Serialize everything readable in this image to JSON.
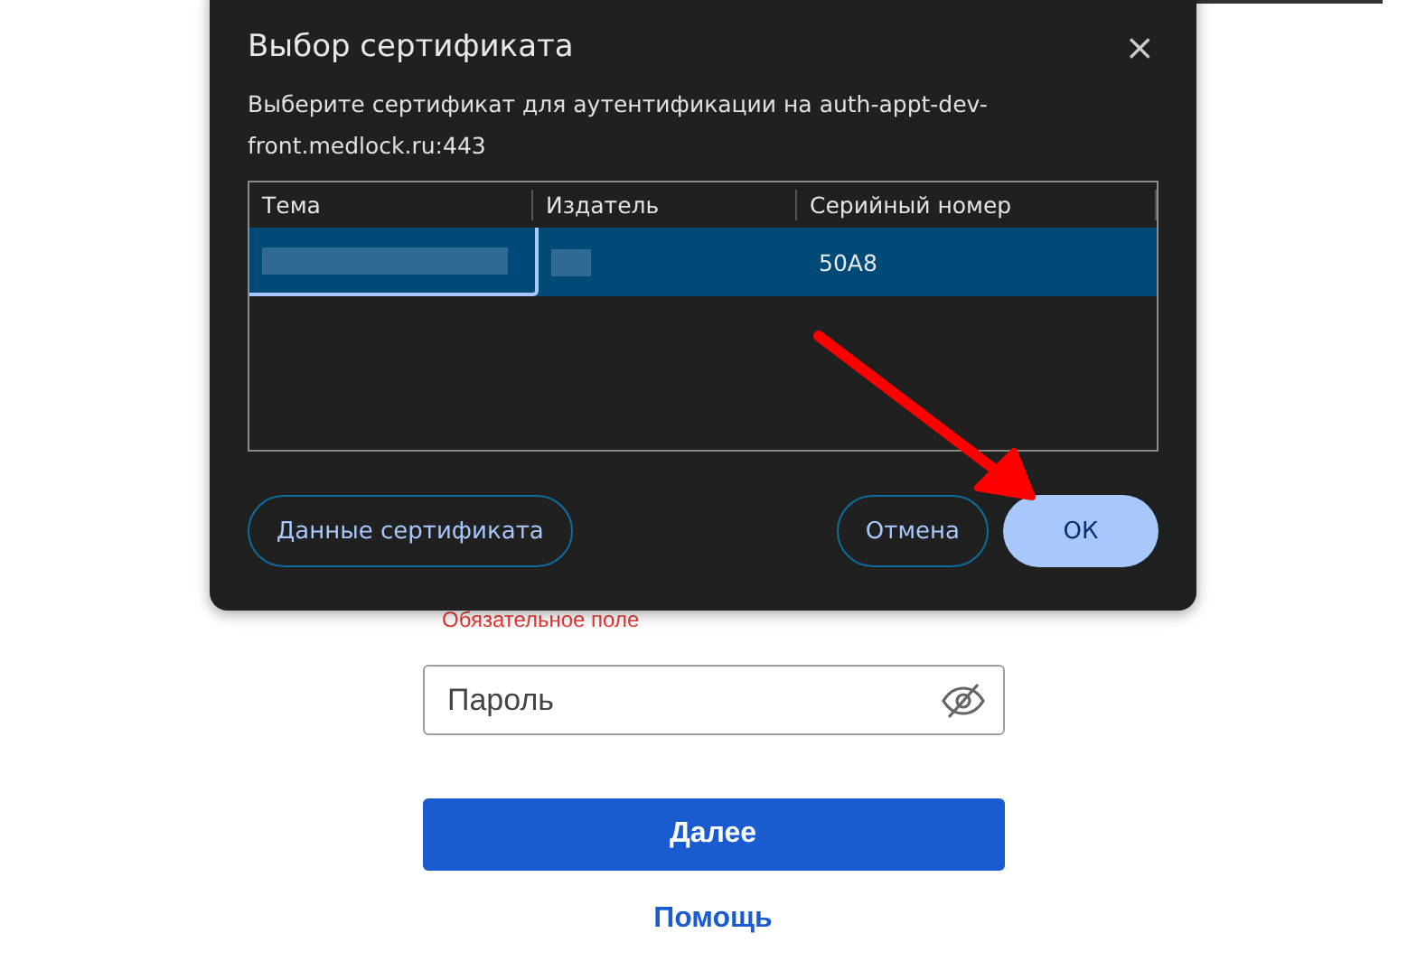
{
  "dialog": {
    "title": "Выбор сертификата",
    "close": "×",
    "description": "Выберите сертификат для аутентификации на auth-appt-dev-front.medlock.ru:443",
    "table": {
      "columns": [
        "Тема",
        "Издатель",
        "Серийный номер"
      ],
      "rows": [
        {
          "selected": true,
          "cells": [
            {
              "redacted": true,
              "focused": true
            },
            {
              "redacted": true,
              "focused": false
            },
            {
              "text": "50A8",
              "focused": false
            }
          ]
        }
      ]
    },
    "buttons": [
      {
        "label": "Данные сертификата",
        "kind": "outline"
      },
      {
        "label": "Отмена",
        "kind": "outline"
      },
      {
        "label": "ОК",
        "kind": "primary"
      }
    ]
  },
  "form": {
    "error": "Обязательное поле",
    "password": {
      "placeholder": "Пароль"
    },
    "submit": "Далее",
    "help": "Помощь"
  }
}
